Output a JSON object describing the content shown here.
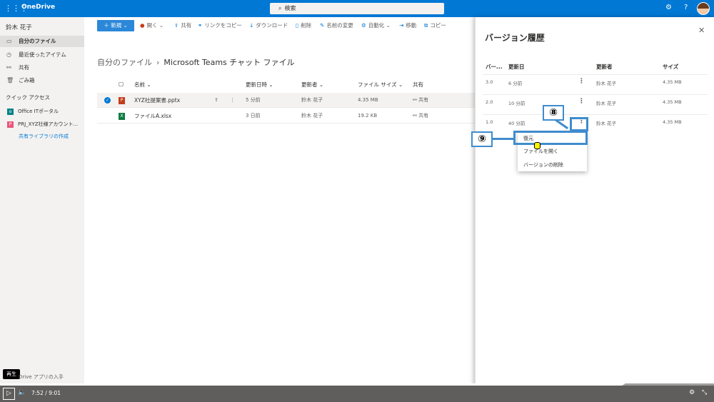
{
  "app": {
    "brand": "OneDrive",
    "search_placeholder": "検索"
  },
  "sidebar": {
    "user": "鈴木 花子",
    "items": [
      {
        "label": "自分のファイル",
        "icon": "folder-icon"
      },
      {
        "label": "最近使ったアイテム",
        "icon": "clock-icon"
      },
      {
        "label": "共有",
        "icon": "share-icon"
      },
      {
        "label": "ごみ箱",
        "icon": "trash-icon"
      }
    ],
    "quick_access_title": "クイック アクセス",
    "quick_items": [
      {
        "label": "Office ITポータル",
        "icon": "site-icon"
      },
      {
        "label": "PRJ_XYZ社様アカウント...",
        "icon": "site-icon"
      }
    ],
    "create_library": "共有ライブラリの作成",
    "get_app": "Drive アプリの入手"
  },
  "toolbar": {
    "new_label": "新規",
    "open": "開く",
    "share": "共有",
    "copy_link": "リンクをコピー",
    "download": "ダウンロード",
    "delete": "削除",
    "rename": "名前の変更",
    "automate": "自動化",
    "move": "移動",
    "copy": "コピー"
  },
  "breadcrumb": {
    "root": "自分のファイル",
    "current": "Microsoft Teams チャット ファイル"
  },
  "files": {
    "headers": {
      "name": "名前",
      "modified": "更新日時",
      "modified_by": "更新者",
      "size": "ファイル サイズ",
      "sharing": "共有"
    },
    "rows": [
      {
        "name": "XYZ社提案書.pptx",
        "modified": "5 分前",
        "modified_by": "鈴木 花子",
        "size": "4.35 MB",
        "sharing": "共有",
        "type": "pptx"
      },
      {
        "name": "ファイルA.xlsx",
        "modified": "3 日前",
        "modified_by": "鈴木 花子",
        "size": "19.2 KB",
        "sharing": "共有",
        "type": "xlsx"
      }
    ]
  },
  "version_panel": {
    "title": "バージョン履歴",
    "headers": {
      "version": "バー...",
      "modified": "更新日",
      "modified_by": "更新者",
      "size": "サイズ"
    },
    "rows": [
      {
        "version": "3.0",
        "modified": "6 分前",
        "modified_by": "鈴木 花子",
        "size": "4.35 MB"
      },
      {
        "version": "2.0",
        "modified": "10 分前",
        "modified_by": "鈴木 花子",
        "size": "4.35 MB"
      },
      {
        "version": "1.0",
        "modified": "40 分前",
        "modified_by": "鈴木 花子",
        "size": "4.35 MB"
      }
    ],
    "menu": [
      "復元",
      "ファイルを開く",
      "バージョンの削除"
    ]
  },
  "annotations": {
    "step8": "⑧",
    "step9": "⑨"
  },
  "player": {
    "tooltip": "再生",
    "current_time": "7:52",
    "separator": "/",
    "duration": "9:01",
    "progress": 0.872
  }
}
